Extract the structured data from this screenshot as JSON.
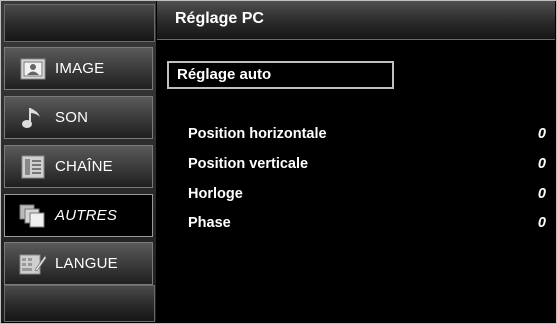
{
  "header": {
    "title": "Réglage PC"
  },
  "sidebar": {
    "items": [
      {
        "label": "IMAGE",
        "icon": "picture-icon"
      },
      {
        "label": "SON",
        "icon": "music-note-icon"
      },
      {
        "label": "CHAÎNE",
        "icon": "channel-list-icon"
      },
      {
        "label": "AUTRES",
        "icon": "stacked-pages-icon",
        "active": true
      },
      {
        "label": "LANGUE",
        "icon": "keyboard-pen-icon"
      }
    ]
  },
  "main": {
    "auto_label": "Réglage auto",
    "settings": [
      {
        "label": "Position horizontale",
        "value": "0"
      },
      {
        "label": "Position verticale",
        "value": "0"
      },
      {
        "label": "Horloge",
        "value": "0"
      },
      {
        "label": "Phase",
        "value": "0"
      }
    ]
  }
}
